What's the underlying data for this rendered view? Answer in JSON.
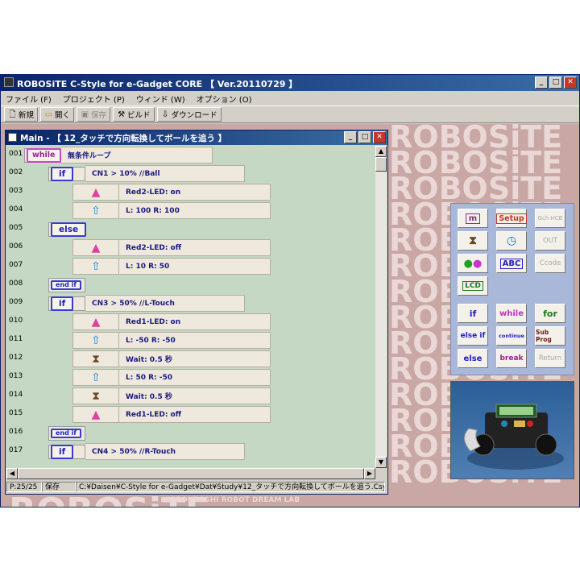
{
  "app": {
    "title": "ROBOSiTE C-Style for e-Gadget CORE 【 Ver.20110729 】",
    "window_buttons": {
      "minimize": "_",
      "maximize": "□",
      "close": "✕"
    }
  },
  "menu": [
    "ファイル (F)",
    "プロジェクト (P)",
    "ウィンド (W)",
    "オプション (O)"
  ],
  "toolbar": {
    "new_label": "新規",
    "open_label": "開く",
    "save_label": "保存",
    "build_label": "ビルド",
    "download_label": "ダウンロード"
  },
  "background": {
    "watermark": "ROBOSiTE",
    "lab_text": "NIPPONBASHI ROBOT DREAM LAB"
  },
  "editor_window": {
    "title": "Main - 【 12_タッチで方向転換してボールを追う 】",
    "rows": [
      {
        "num": "001",
        "kw": "while",
        "text": "無条件ループ"
      },
      {
        "num": "002",
        "kw": "if",
        "text": "CN1 > 10%  //Ball"
      },
      {
        "num": "003",
        "icon": "led-icon",
        "text": "Red2-LED: on"
      },
      {
        "num": "004",
        "icon": "motor-icon",
        "text": "L: 100  R: 100"
      },
      {
        "num": "005",
        "kw": "else",
        "text": ""
      },
      {
        "num": "006",
        "icon": "led-icon",
        "text": "Red2-LED: off"
      },
      {
        "num": "007",
        "icon": "motor-icon",
        "text": "L:  10  R:  50"
      },
      {
        "num": "008",
        "kw": "end if",
        "text": ""
      },
      {
        "num": "009",
        "kw": "if",
        "text": "CN3 > 50%  //L-Touch"
      },
      {
        "num": "010",
        "icon": "led-icon",
        "text": "Red1-LED: on"
      },
      {
        "num": "011",
        "icon": "motor-icon",
        "text": "L: -50  R: -50"
      },
      {
        "num": "012",
        "icon": "hourglass-icon",
        "text": "Wait: 0.5 秒"
      },
      {
        "num": "013",
        "icon": "motor-icon",
        "text": "L:  50  R: -50"
      },
      {
        "num": "014",
        "icon": "hourglass-icon",
        "text": "Wait: 0.5 秒"
      },
      {
        "num": "015",
        "icon": "led-icon",
        "text": "Red1-LED: off"
      },
      {
        "num": "016",
        "kw": "end if",
        "text": ""
      },
      {
        "num": "017",
        "kw": "if",
        "text": "CN4 > 50%  //R-Touch"
      }
    ],
    "status": {
      "position": "P:25/25",
      "save_state": "保存",
      "path": "C:¥Daisen¥C-Style for e-Gadget¥Dat¥Study¥12_タッチで方向転換してボールを追う.Csy"
    }
  },
  "palette": {
    "buttons": [
      {
        "name": "motor-block",
        "label": "m",
        "enabled": true
      },
      {
        "name": "setup-block",
        "label": "Setup",
        "enabled": true
      },
      {
        "name": "gchcb-block",
        "label": "Gch HCB",
        "enabled": false
      },
      {
        "name": "wait-block",
        "label": "⧗",
        "enabled": true
      },
      {
        "name": "timer-block",
        "label": "◷",
        "enabled": true
      },
      {
        "name": "out-block",
        "label": "OUT",
        "enabled": false
      },
      {
        "name": "led-block",
        "label": "LED",
        "enabled": true
      },
      {
        "name": "abc-block",
        "label": "ABC",
        "enabled": true
      },
      {
        "name": "ccode-block",
        "label": "Ccode",
        "enabled": false
      },
      {
        "name": "lcd-block",
        "label": "LCD",
        "enabled": true
      },
      {
        "name": "if-block",
        "label": "if",
        "enabled": true
      },
      {
        "name": "while-block",
        "label": "while",
        "enabled": true
      },
      {
        "name": "for-block",
        "label": "for",
        "enabled": true
      },
      {
        "name": "elseif-block",
        "label": "else if",
        "enabled": true
      },
      {
        "name": "continue-block",
        "label": "continue",
        "enabled": true
      },
      {
        "name": "subprog-block",
        "label": "Sub Prog",
        "enabled": true
      },
      {
        "name": "else-block",
        "label": "else",
        "enabled": true
      },
      {
        "name": "break-block",
        "label": "break",
        "enabled": true
      },
      {
        "name": "return-block",
        "label": "Return",
        "enabled": false
      }
    ]
  },
  "colors": {
    "title_dark": "#0a246a",
    "editor_bg": "#c5d8c3",
    "block_bg": "#eee9dc",
    "keyword_blue": "#2020c0",
    "keyword_pink": "#a0209a",
    "background": "#c9a7a4"
  }
}
